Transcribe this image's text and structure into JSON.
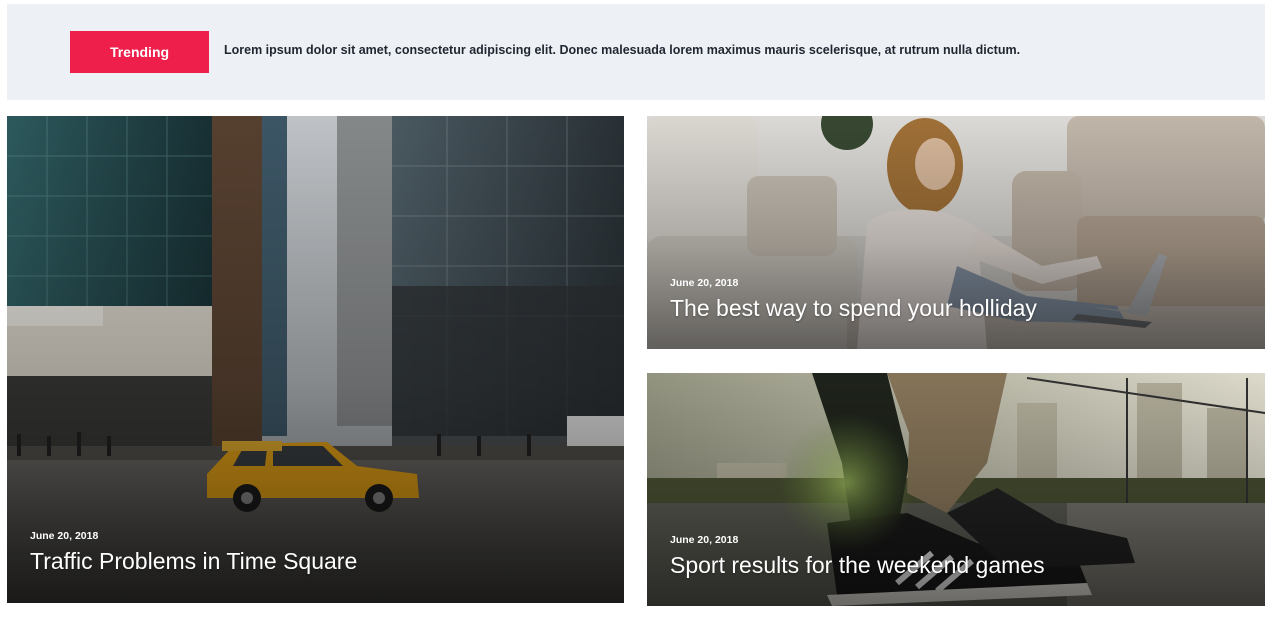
{
  "trending": {
    "label": "Trending",
    "text": "Lorem ipsum dolor sit amet, consectetur adipiscing elit. Donec malesuada lorem maximus mauris scelerisque, at rutrum nulla dictum."
  },
  "cards": [
    {
      "date": "June 20, 2018",
      "title": "Traffic Problems in Time Square"
    },
    {
      "date": "June 20, 2018",
      "title": "The best way to spend your holliday"
    },
    {
      "date": "June 20, 2018",
      "title": "Sport results for the weekend games"
    }
  ],
  "colors": {
    "accent": "#ee1f4b",
    "bar_bg": "#edf1f6"
  }
}
